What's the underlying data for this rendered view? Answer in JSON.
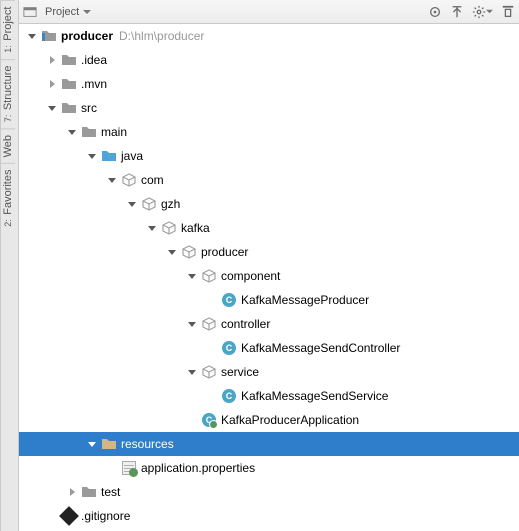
{
  "toolbar": {
    "title": "Project"
  },
  "sidebar": {
    "tabs": [
      {
        "num": "1:",
        "label": "Project"
      },
      {
        "num": "7:",
        "label": "Structure"
      },
      {
        "num": "",
        "label": "Web"
      },
      {
        "num": "2:",
        "label": "Favorites"
      }
    ]
  },
  "tree": [
    {
      "indent": 0,
      "arrow": "expanded",
      "icon": "module",
      "label": "producer",
      "bold": true,
      "path": "D:\\hlm\\producer"
    },
    {
      "indent": 1,
      "arrow": "collapsed",
      "icon": "folder",
      "label": ".idea"
    },
    {
      "indent": 1,
      "arrow": "collapsed",
      "icon": "folder",
      "label": ".mvn"
    },
    {
      "indent": 1,
      "arrow": "expanded",
      "icon": "folder",
      "label": "src"
    },
    {
      "indent": 2,
      "arrow": "expanded",
      "icon": "folder",
      "label": "main"
    },
    {
      "indent": 3,
      "arrow": "expanded",
      "icon": "src",
      "label": "java"
    },
    {
      "indent": 4,
      "arrow": "expanded",
      "icon": "pkg",
      "label": "com"
    },
    {
      "indent": 5,
      "arrow": "expanded",
      "icon": "pkg",
      "label": "gzh"
    },
    {
      "indent": 6,
      "arrow": "expanded",
      "icon": "pkg",
      "label": "kafka"
    },
    {
      "indent": 7,
      "arrow": "expanded",
      "icon": "pkg",
      "label": "producer"
    },
    {
      "indent": 8,
      "arrow": "expanded",
      "icon": "pkg",
      "label": "component"
    },
    {
      "indent": 9,
      "arrow": "none",
      "icon": "class",
      "label": "KafkaMessageProducer"
    },
    {
      "indent": 8,
      "arrow": "expanded",
      "icon": "pkg",
      "label": "controller"
    },
    {
      "indent": 9,
      "arrow": "none",
      "icon": "class",
      "label": "KafkaMessageSendController"
    },
    {
      "indent": 8,
      "arrow": "expanded",
      "icon": "pkg",
      "label": "service"
    },
    {
      "indent": 9,
      "arrow": "none",
      "icon": "class",
      "label": "KafkaMessageSendService"
    },
    {
      "indent": 8,
      "arrow": "none",
      "icon": "classMain",
      "label": "KafkaProducerApplication"
    },
    {
      "indent": 3,
      "arrow": "expanded",
      "icon": "res",
      "label": "resources",
      "selected": true
    },
    {
      "indent": 4,
      "arrow": "none",
      "icon": "prop",
      "label": "application.properties"
    },
    {
      "indent": 2,
      "arrow": "collapsed",
      "icon": "folder",
      "label": "test"
    },
    {
      "indent": 1,
      "arrow": "none",
      "icon": "gitignore",
      "label": ".gitignore"
    }
  ]
}
